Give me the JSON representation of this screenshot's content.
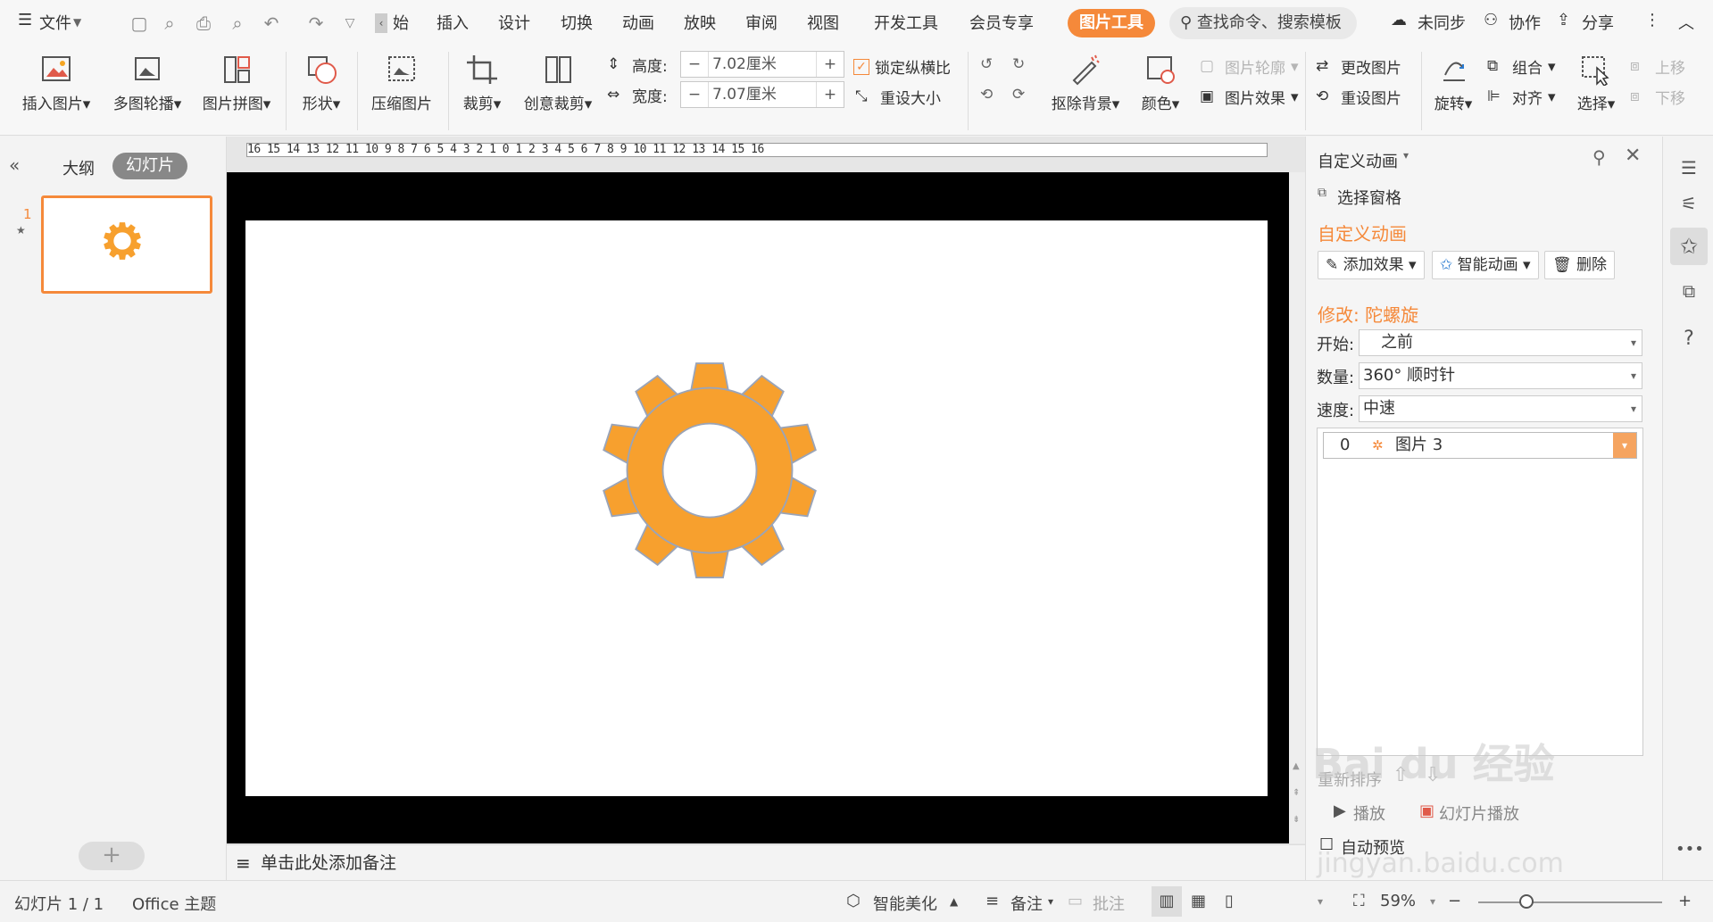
{
  "menubar": {
    "file_label": "文件",
    "tabs": [
      "始",
      "插入",
      "设计",
      "切换",
      "动画",
      "放映",
      "审阅",
      "视图",
      "开发工具",
      "会员专享"
    ],
    "active_tool_tab": "图片工具",
    "search_placeholder": "查找命令、搜索模板",
    "sync_label": "未同步",
    "collab_label": "协作",
    "share_label": "分享"
  },
  "ribbon": {
    "insert_picture": "插入图片",
    "multi_carousel": "多图轮播",
    "picture_collage": "图片拼图",
    "shape": "形状",
    "compress": "压缩图片",
    "crop": "裁剪",
    "creative_crop": "创意裁剪",
    "height_label": "高度:",
    "height_value": "7.02厘米",
    "width_label": "宽度:",
    "width_value": "7.07厘米",
    "lock_ratio": "锁定纵横比",
    "reset_size": "重设大小",
    "remove_bg": "抠除背景",
    "color": "颜色",
    "picture_outline": "图片轮廓",
    "picture_effect": "图片效果",
    "change_picture": "更改图片",
    "reset_picture": "重设图片",
    "rotate": "旋转",
    "group": "组合",
    "align": "对齐",
    "select": "选择",
    "move_up": "上移",
    "move_down": "下移"
  },
  "leftpanel": {
    "tab_outline": "大纲",
    "tab_slides": "幻灯片",
    "slide_number": "1",
    "add_label": "+"
  },
  "ruler": {
    "text": "16 15 14 13 12 11 10 9 8 7 6 5 4 3 2 1 0 1 2 3 4 5 6 7 8 9 10 11 12 13 14 15 16"
  },
  "notes": {
    "placeholder": "单击此处添加备注"
  },
  "rightpanel": {
    "panel_title": "自定义动画",
    "selection_pane": "选择窗格",
    "section_title": "自定义动画",
    "add_effect": "添加效果",
    "smart_anim": "智能动画",
    "delete": "删除",
    "modify_title": "修改: 陀螺旋",
    "start_label": "开始:",
    "start_value": "之前",
    "amount_label": "数量:",
    "amount_value": "360° 顺时针",
    "speed_label": "速度:",
    "speed_value": "中速",
    "anim_index": "0",
    "anim_name": "图片 3",
    "reorder": "重新排序",
    "play": "播放",
    "slideshow": "幻灯片播放",
    "auto_preview": "自动预览"
  },
  "statusbar": {
    "slide_info": "幻灯片 1 / 1",
    "theme": "Office 主题",
    "smart_beautify": "智能美化",
    "notes": "备注",
    "comments": "批注",
    "zoom": "59%"
  },
  "colors": {
    "accent": "#f5893a",
    "gear": "#f7a02e"
  }
}
